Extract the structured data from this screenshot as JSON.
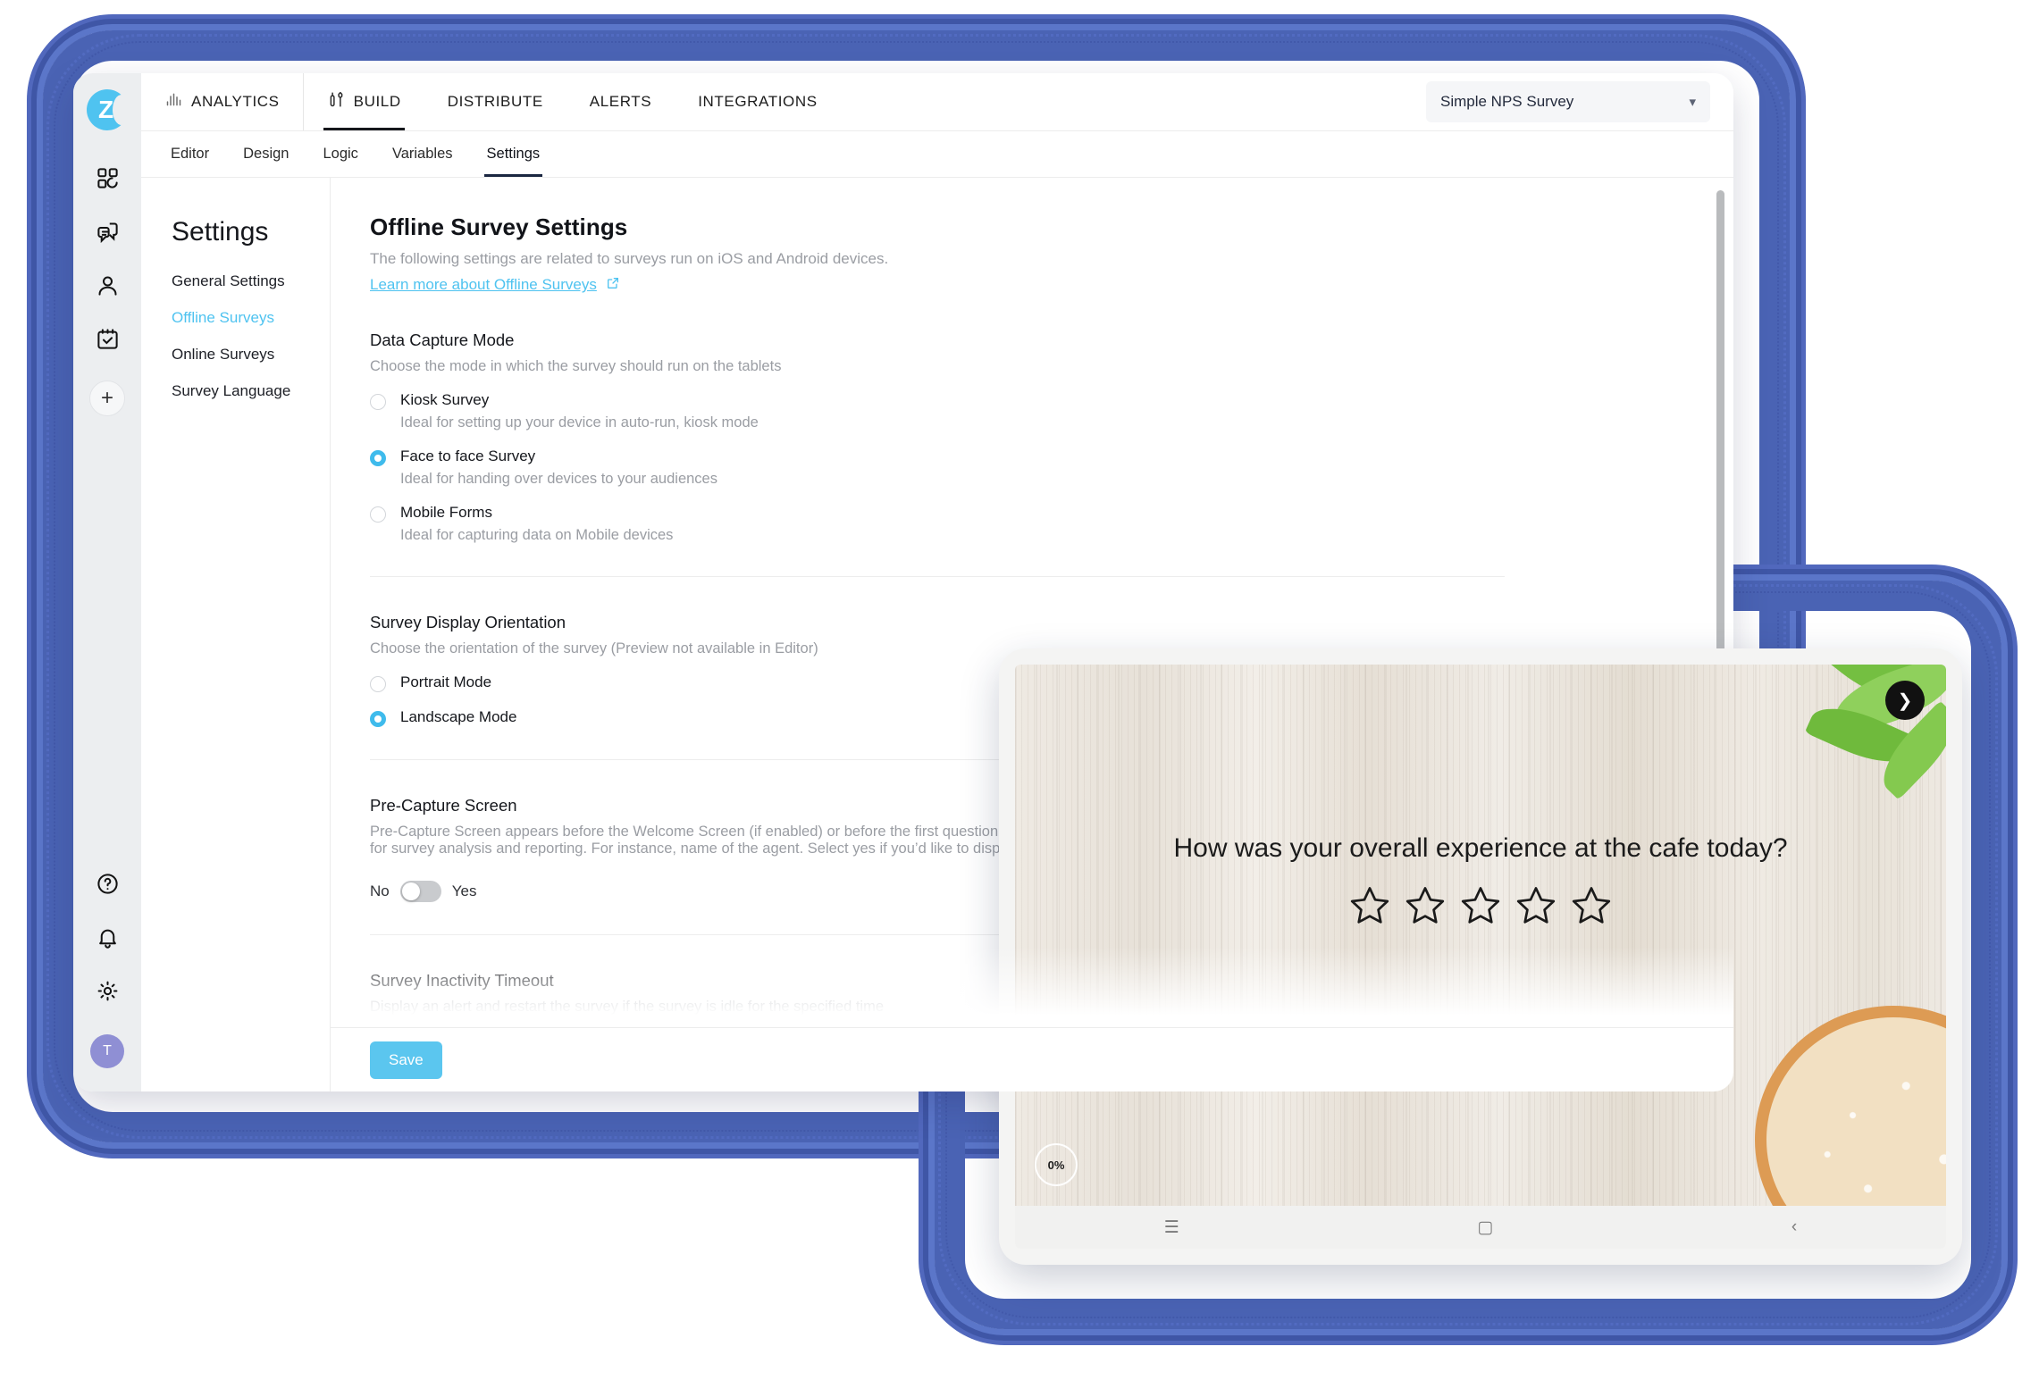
{
  "brand": {
    "logo_letter": "Z",
    "accent": "#4fc3f0",
    "frame_blue": "#4a63b4"
  },
  "topbar": {
    "nav": [
      {
        "label": "ANALYTICS",
        "icon": "bar-chart-icon",
        "active": false
      },
      {
        "label": "BUILD",
        "icon": "wrench-screwdriver-icon",
        "active": true
      },
      {
        "label": "DISTRIBUTE",
        "icon": "",
        "active": false
      },
      {
        "label": "ALERTS",
        "icon": "",
        "active": false
      },
      {
        "label": "INTEGRATIONS",
        "icon": "",
        "active": false
      }
    ],
    "survey_select": {
      "value": "Simple NPS Survey",
      "chevron": "chevron-down-icon"
    }
  },
  "subtabs": [
    {
      "label": "Editor",
      "active": false
    },
    {
      "label": "Design",
      "active": false
    },
    {
      "label": "Logic",
      "active": false
    },
    {
      "label": "Variables",
      "active": false
    },
    {
      "label": "Settings",
      "active": true
    }
  ],
  "rail": {
    "icons": [
      "dashboard-grid-icon",
      "feedback-chat-icon",
      "contacts-person-icon",
      "tasks-calendar-check-icon"
    ],
    "add_label": "+",
    "bottom_icons": [
      "help-question-icon",
      "notifications-bell-icon",
      "settings-gear-icon"
    ],
    "avatar_initial": "T"
  },
  "settings_nav": {
    "title": "Settings",
    "items": [
      {
        "label": "General Settings",
        "active": false
      },
      {
        "label": "Offline Surveys",
        "active": true
      },
      {
        "label": "Online Surveys",
        "active": false
      },
      {
        "label": "Survey Language",
        "active": false
      }
    ]
  },
  "page": {
    "title": "Offline Survey Settings",
    "subtitle": "The following settings are related to surveys run on iOS and Android devices.",
    "learn_more": "Learn more about Offline Surveys",
    "learn_more_icon": "external-link-icon"
  },
  "data_capture": {
    "heading": "Data Capture Mode",
    "subtext": "Choose the mode in which the survey should run on the tablets",
    "options": [
      {
        "label": "Kiosk Survey",
        "desc": "Ideal for setting up your device in auto-run, kiosk mode",
        "selected": false
      },
      {
        "label": "Face to face Survey",
        "desc": "Ideal for handing over devices to your audiences",
        "selected": true
      },
      {
        "label": "Mobile Forms",
        "desc": "Ideal for capturing data on Mobile devices",
        "selected": false
      }
    ]
  },
  "orientation": {
    "heading": "Survey Display Orientation",
    "subtext": "Choose the orientation of the survey (Preview not available in Editor)",
    "options": [
      {
        "label": "Portrait Mode",
        "selected": false
      },
      {
        "label": "Landscape Mode",
        "selected": true
      }
    ]
  },
  "pre_capture": {
    "heading": "Pre-Capture Screen",
    "subtext": "Pre-Capture Screen appears before the Welcome Screen (if enabled) or before the first question of the survey. It is used to capture information about the survey respondent for survey analysis and reporting. For instance, name of the agent. Select yes if you’d like to display the Pre-Capture Screen in the survey.",
    "toggle": {
      "off_label": "No",
      "on_label": "Yes",
      "value": "No"
    }
  },
  "inactivity": {
    "heading": "Survey Inactivity Timeout",
    "subtext": "Display an alert and restart the survey if the survey is idle for the specified time"
  },
  "footer": {
    "save_label": "Save"
  },
  "tablet": {
    "question": "How was your overall experience at the cafe today?",
    "rating_stars": 5,
    "progress": "0%",
    "next_icon": "chevron-right-icon",
    "android_nav": [
      "recents-icon",
      "home-icon",
      "back-icon"
    ]
  }
}
